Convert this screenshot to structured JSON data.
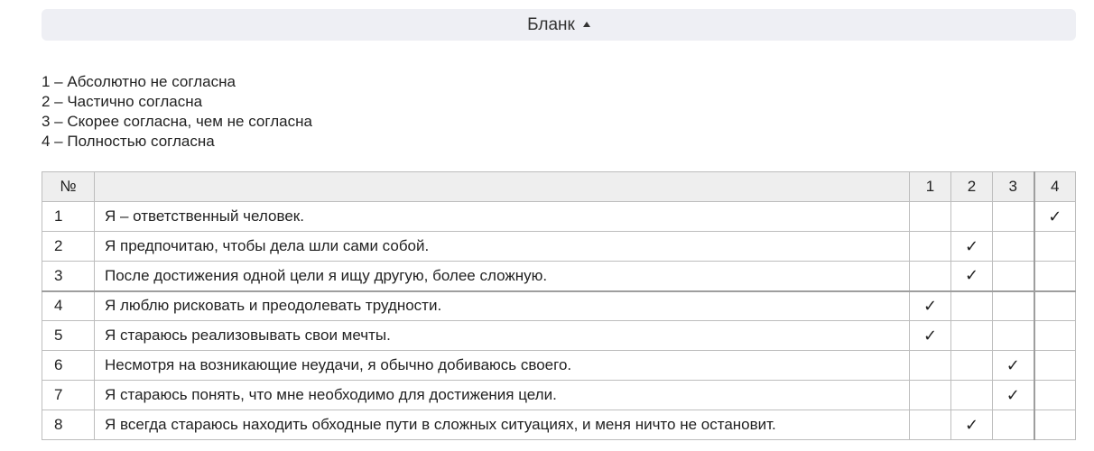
{
  "collapse": {
    "label": "Бланк"
  },
  "legend": [
    "1 – Абсолютно не согласна",
    "2 – Частично согласна",
    "3 – Скорее согласна, чем не согласна",
    "4 – Полностью согласна"
  ],
  "table": {
    "headers": {
      "num": "№",
      "statement": "",
      "options": [
        "1",
        "2",
        "3",
        "4"
      ]
    },
    "check_symbol": "✓",
    "rows": [
      {
        "num": "1",
        "statement": "Я – ответственный человек.",
        "selected": 4
      },
      {
        "num": "2",
        "statement": "Я предпочитаю, чтобы дела шли сами собой.",
        "selected": 2
      },
      {
        "num": "3",
        "statement": "После достижения одной цели я ищу другую, более сложную.",
        "selected": 2
      },
      {
        "num": "4",
        "statement": "Я люблю рисковать и преодолевать трудности.",
        "selected": 1
      },
      {
        "num": "5",
        "statement": "Я стараюсь реализовывать свои мечты.",
        "selected": 1
      },
      {
        "num": "6",
        "statement": "Несмотря на возникающие неудачи, я обычно добиваюсь своего.",
        "selected": 3
      },
      {
        "num": "7",
        "statement": "Я стараюсь понять, что мне необходимо для достижения цели.",
        "selected": 3
      },
      {
        "num": "8",
        "statement": "Я всегда стараюсь находить обходные пути в сложных ситуациях, и меня ничто не остановит.",
        "selected": 2
      }
    ]
  }
}
